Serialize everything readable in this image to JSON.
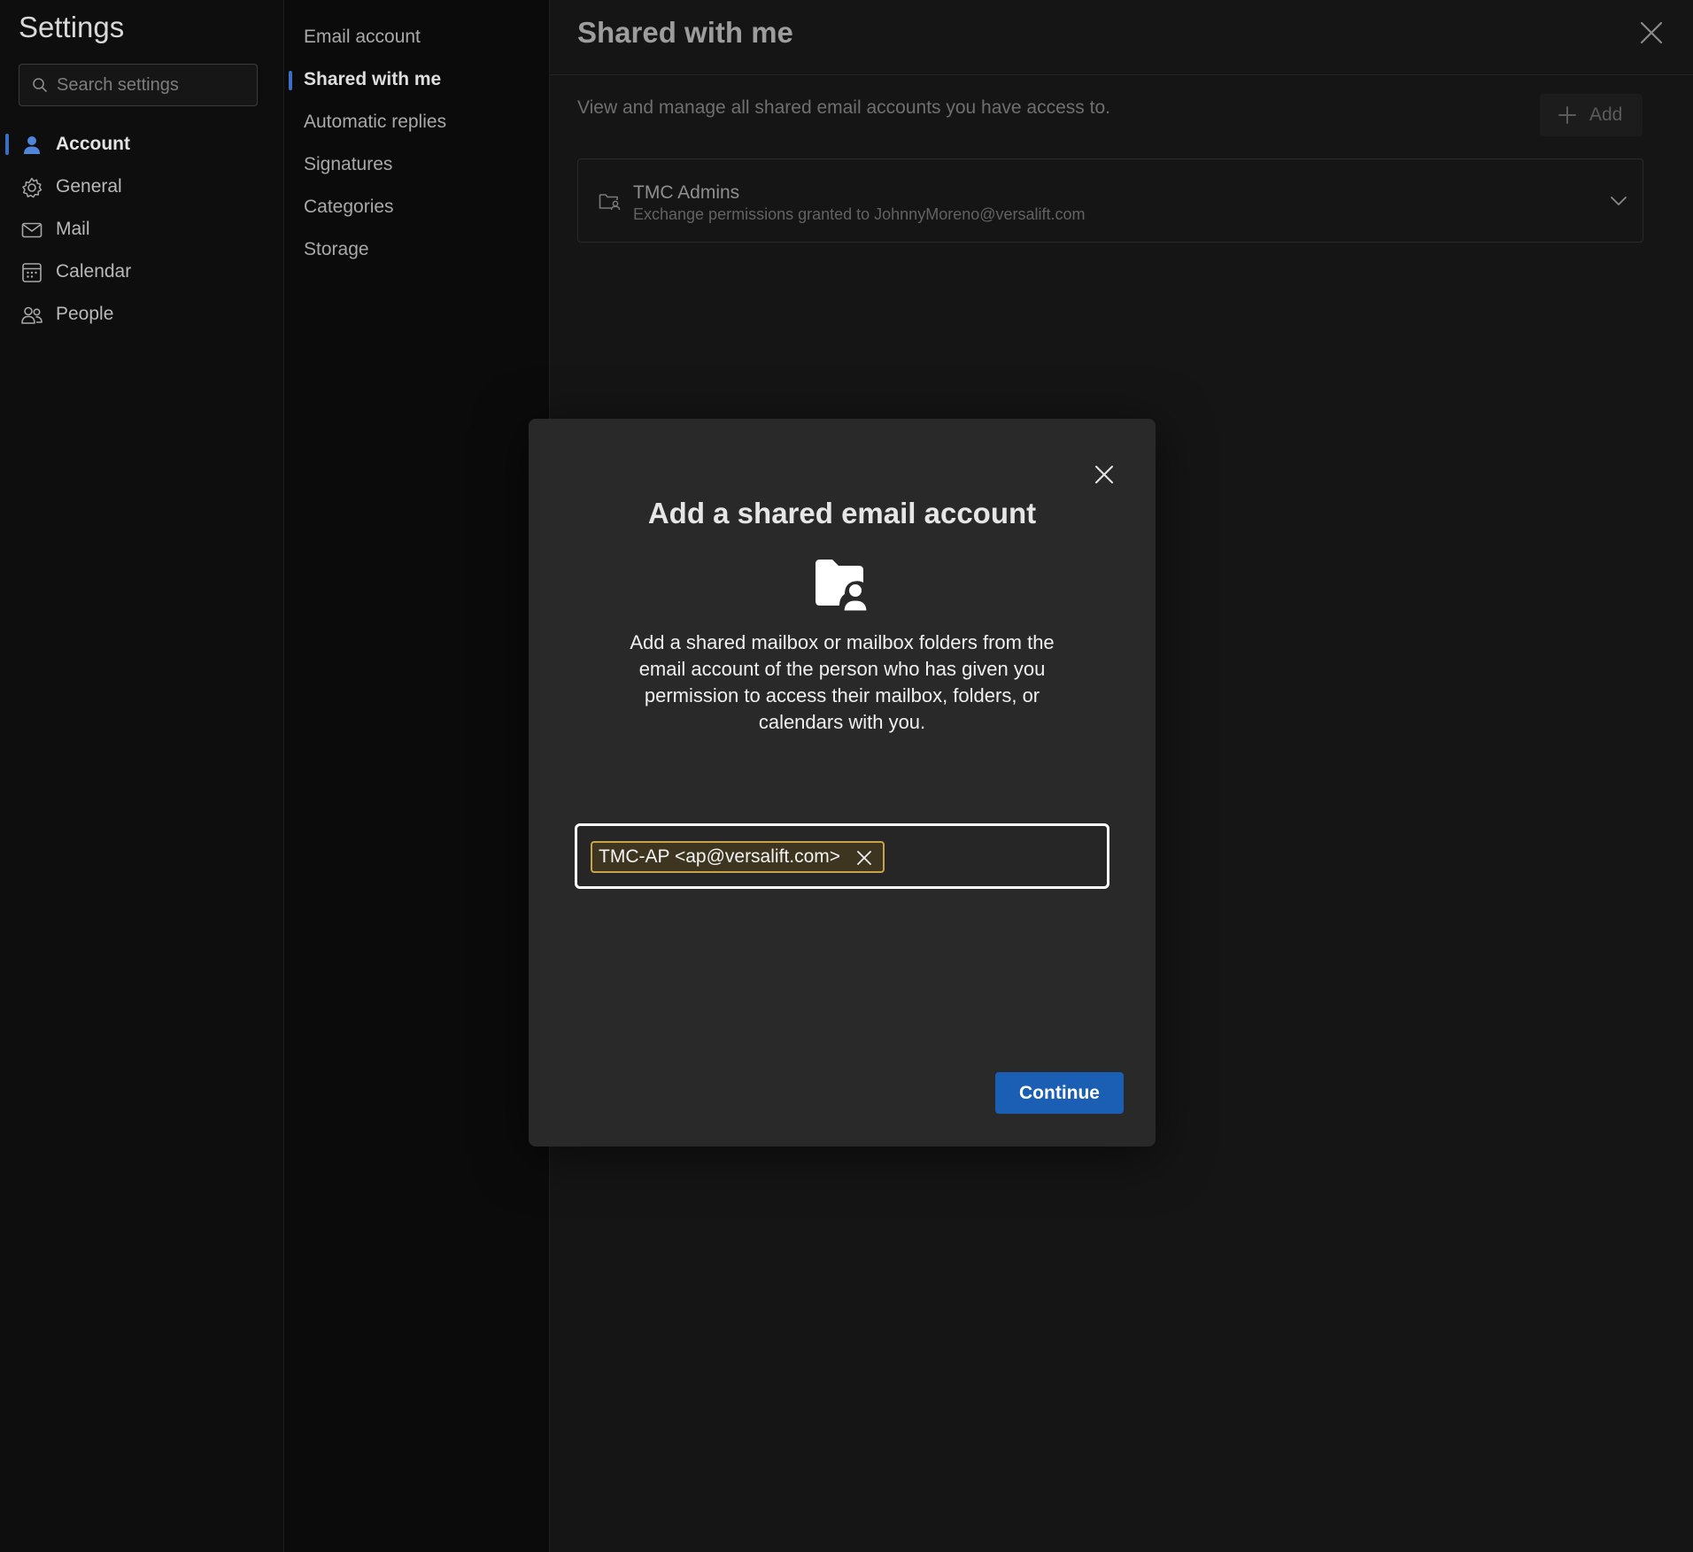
{
  "settings": {
    "title": "Settings",
    "search_placeholder": "Search settings"
  },
  "nav": {
    "items": [
      {
        "label": "Account",
        "icon": "person-icon",
        "active": true
      },
      {
        "label": "General",
        "icon": "gear-icon",
        "active": false
      },
      {
        "label": "Mail",
        "icon": "mail-icon",
        "active": false
      },
      {
        "label": "Calendar",
        "icon": "calendar-icon",
        "active": false
      },
      {
        "label": "People",
        "icon": "people-icon",
        "active": false
      }
    ]
  },
  "subnav": {
    "items": [
      {
        "label": "Email account",
        "active": false
      },
      {
        "label": "Shared with me",
        "active": true
      },
      {
        "label": "Automatic replies",
        "active": false
      },
      {
        "label": "Signatures",
        "active": false
      },
      {
        "label": "Categories",
        "active": false
      },
      {
        "label": "Storage",
        "active": false
      }
    ]
  },
  "main": {
    "title": "Shared with me",
    "description": "View and manage all shared email accounts you have access to.",
    "add_label": "Add",
    "accounts": [
      {
        "name": "TMC Admins",
        "subtitle": "Exchange permissions granted to JohnnyMoreno@versalift.com"
      }
    ]
  },
  "dialog": {
    "title": "Add a shared email account",
    "description": "Add a shared mailbox or mailbox folders from the email account of the person who has given you permission to access their mailbox, folders, or calendars with you.",
    "recipient_chip": "TMC-AP <ap@versalift.com>",
    "continue_label": "Continue"
  },
  "colors": {
    "accent": "#1a5fb4",
    "nav_indicator": "#3a6fc4",
    "chip_border": "#c8a24a",
    "dialog_bg": "#292929",
    "page_bg": "#141414"
  }
}
